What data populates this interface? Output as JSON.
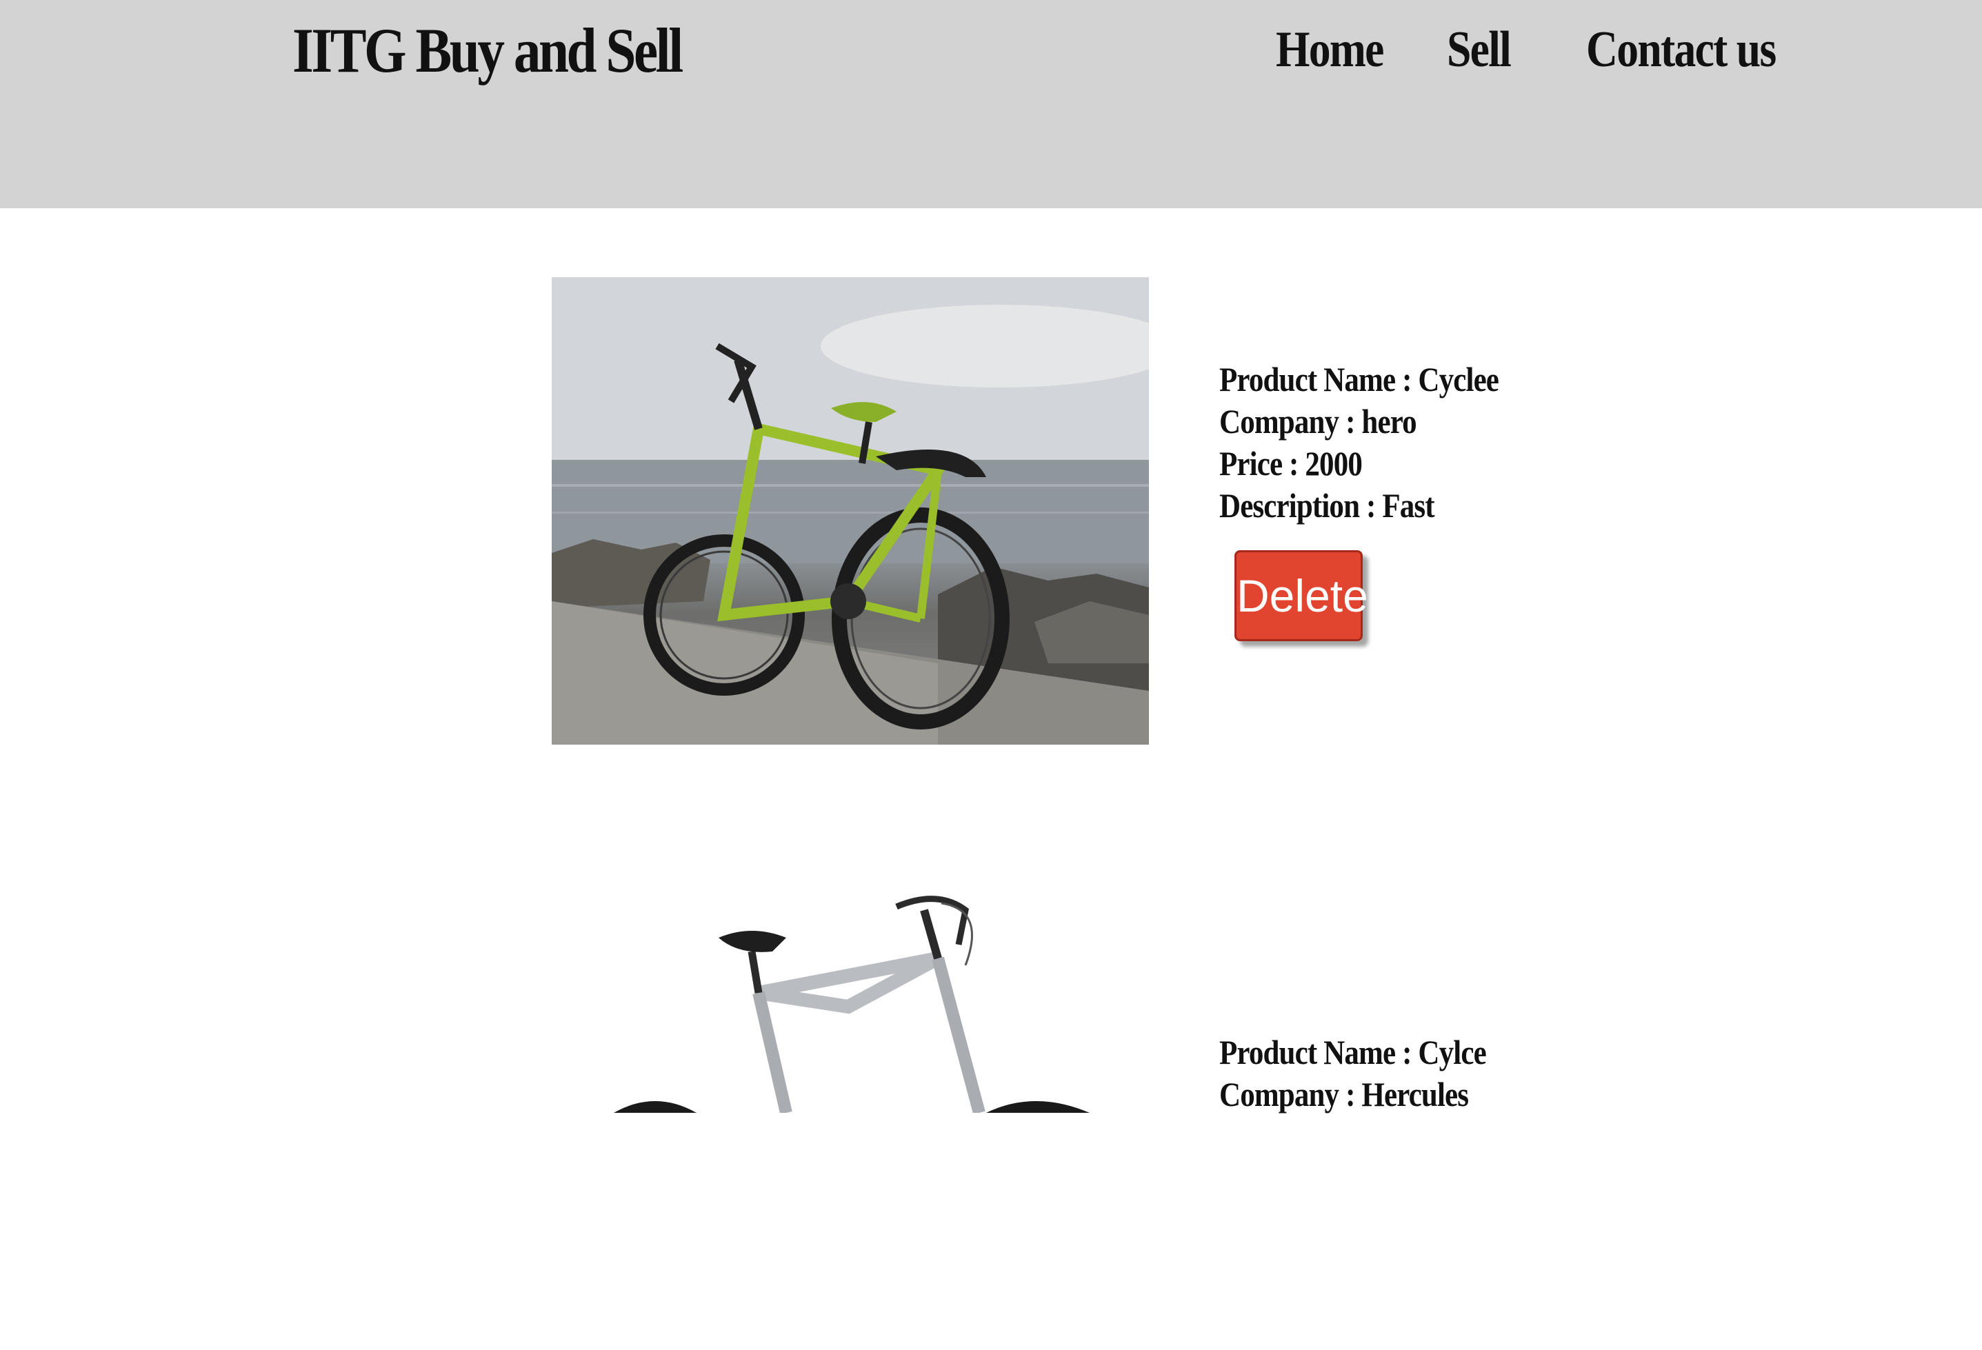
{
  "header": {
    "title": "IITG Buy and Sell",
    "nav": [
      {
        "label": "Home"
      },
      {
        "label": "Sell"
      },
      {
        "label": "Contact us"
      }
    ]
  },
  "colors": {
    "header_bg": "#d3d3d3",
    "delete_button": "#e2452f",
    "text": "#111111"
  },
  "products": [
    {
      "name_line": "Product Name : Cyclee",
      "company_line": "Company : hero",
      "price_line": "Price : 2000",
      "description_line": "Description : Fast",
      "delete_label": "Delete",
      "image_subject": "green-bicycle-by-sea"
    },
    {
      "name_line": "Product Name : Cylce",
      "company_line": "Company : Hercules",
      "image_subject": "silver-bicycle"
    }
  ]
}
